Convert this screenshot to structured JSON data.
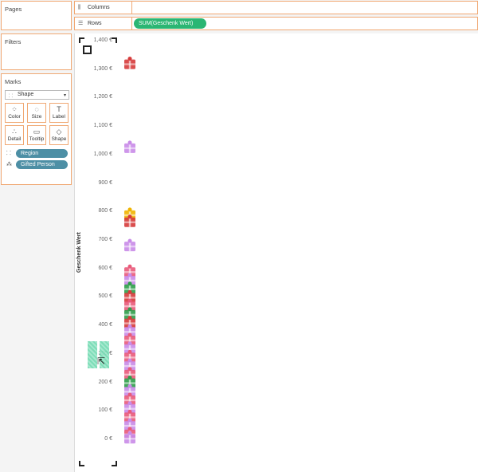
{
  "pages": {
    "title": "Pages"
  },
  "filters": {
    "title": "Filters"
  },
  "marks": {
    "title": "Marks",
    "mark_type": "Shape",
    "buttons": [
      {
        "label": "Color",
        "icon": "color-icon"
      },
      {
        "label": "Size",
        "icon": "size-icon"
      },
      {
        "label": "Label",
        "icon": "label-icon"
      },
      {
        "label": "Detail",
        "icon": "detail-icon"
      },
      {
        "label": "Tooltip",
        "icon": "tooltip-icon"
      },
      {
        "label": "Shape",
        "icon": "shape-icon"
      }
    ],
    "fields": [
      {
        "label": "Region",
        "icon": "shape-field-icon"
      },
      {
        "label": "Gifted Person",
        "icon": "detail-field-icon"
      }
    ]
  },
  "shelves": {
    "columns": {
      "label": "Columns"
    },
    "rows": {
      "label": "Rows",
      "pill": "SUM(Geschenk Wert)"
    }
  },
  "chart_data": {
    "type": "scatter",
    "ylabel": "Geschenk Wert",
    "ylim": [
      0,
      1400
    ],
    "y_ticks": [
      "0 €",
      "100 €",
      "200 €",
      "300 €",
      "400 €",
      "500 €",
      "600 €",
      "700 €",
      "800 €",
      "900 €",
      "1,000 €",
      "1,100 €",
      "1,200 €",
      "1,300 €",
      "1,400 €"
    ],
    "points": [
      {
        "y": 1320,
        "color": "#d63b3b"
      },
      {
        "y": 1025,
        "color": "#c98be8"
      },
      {
        "y": 790,
        "color": "#f0b400"
      },
      {
        "y": 765,
        "color": "#d63b3b"
      },
      {
        "y": 680,
        "color": "#c98be8"
      },
      {
        "y": 590,
        "color": "#e95a7a"
      },
      {
        "y": 560,
        "color": "#c98be8"
      },
      {
        "y": 530,
        "color": "#2e9e4a"
      },
      {
        "y": 500,
        "color": "#d63b3b"
      },
      {
        "y": 470,
        "color": "#e95a7a"
      },
      {
        "y": 440,
        "color": "#2e9e4a"
      },
      {
        "y": 410,
        "color": "#d63b3b"
      },
      {
        "y": 380,
        "color": "#c98be8"
      },
      {
        "y": 350,
        "color": "#e95a7a"
      },
      {
        "y": 320,
        "color": "#c98be8"
      },
      {
        "y": 290,
        "color": "#e95a7a"
      },
      {
        "y": 260,
        "color": "#c98be8"
      },
      {
        "y": 230,
        "color": "#e95a7a"
      },
      {
        "y": 200,
        "color": "#2e9e4a"
      },
      {
        "y": 170,
        "color": "#c98be8"
      },
      {
        "y": 140,
        "color": "#e95a7a"
      },
      {
        "y": 110,
        "color": "#c98be8"
      },
      {
        "y": 80,
        "color": "#e95a7a"
      },
      {
        "y": 50,
        "color": "#c98be8"
      },
      {
        "y": 20,
        "color": "#e95a7a"
      },
      {
        "y": 5,
        "color": "#c98be8"
      }
    ]
  }
}
